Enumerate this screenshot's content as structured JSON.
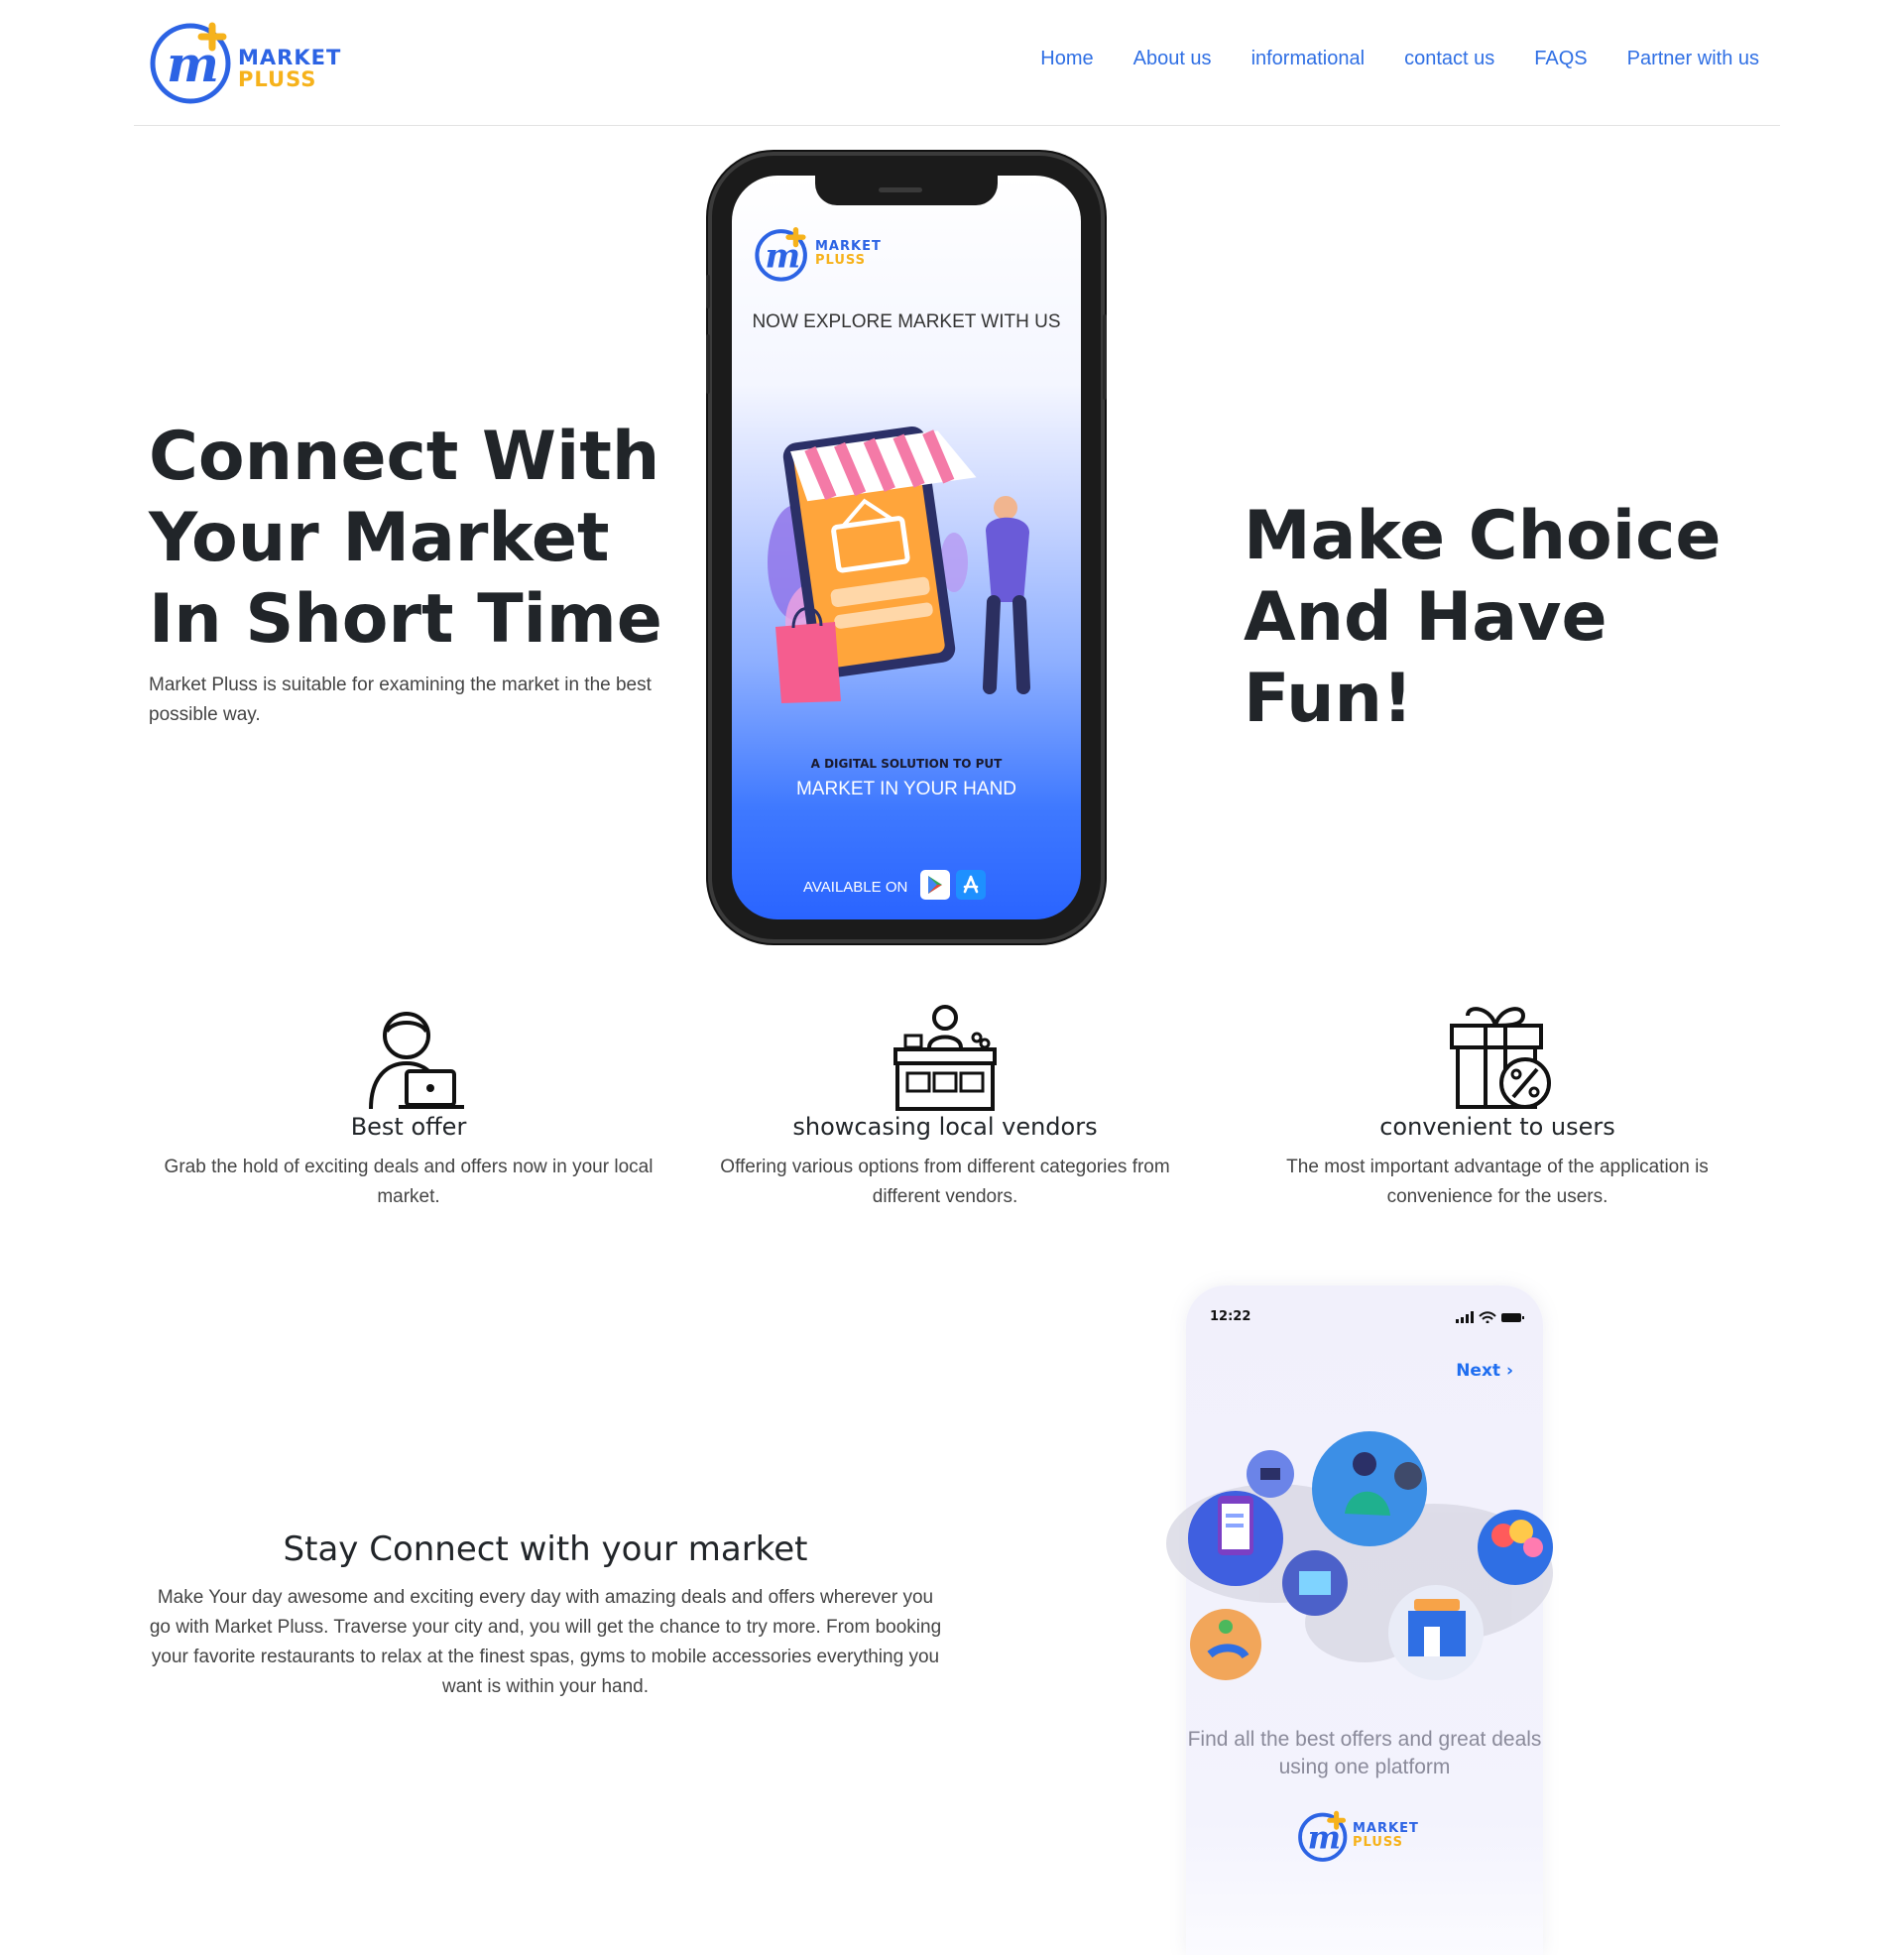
{
  "brand": {
    "name_top": "MARKET",
    "name_bottom": "PLUSS",
    "primary_color": "#2c63e4",
    "accent_color": "#f6b21b"
  },
  "nav": {
    "items": [
      "Home",
      "About us",
      "informational",
      "contact us",
      "FAQS",
      "Partner with us"
    ]
  },
  "hero": {
    "title": "Connect With Your Market In Short Time",
    "text": "Market Pluss is suitable for examining the market in the best possible way.",
    "tagline": "Make Choice And Have Fun!"
  },
  "phone1": {
    "headline": "NOW EXPLORE MARKET WITH US",
    "sub": "A DIGITAL SOLUTION TO PUT",
    "main": "MARKET IN YOUR HAND",
    "available": "AVAILABLE ON",
    "stores": [
      "google-play-icon",
      "app-store-icon"
    ]
  },
  "features": [
    {
      "icon": "support-agent-icon",
      "title": "Best offer",
      "text": "Grab the hold of exciting deals and offers now in your local market."
    },
    {
      "icon": "vendor-stall-icon",
      "title": "showcasing local vendors",
      "text": "Offering various options from different categories from different vendors."
    },
    {
      "icon": "gift-discount-icon",
      "title": "convenient to users",
      "text": "The most important advantage of the application is convenience for the users."
    }
  ],
  "stay": {
    "title": "Stay Connect with your market",
    "text": "Make Your day awesome and exciting every day with amazing deals and offers wherever you go with Market Pluss. Traverse your city and, you will get the chance to try more. From booking your favorite restaurants to relax at the finest spas, gyms to mobile accessories everything you want is within your hand."
  },
  "phone2": {
    "time": "12:22",
    "next": "Next",
    "caption": "Find all the best offers and great deals using one platform"
  }
}
